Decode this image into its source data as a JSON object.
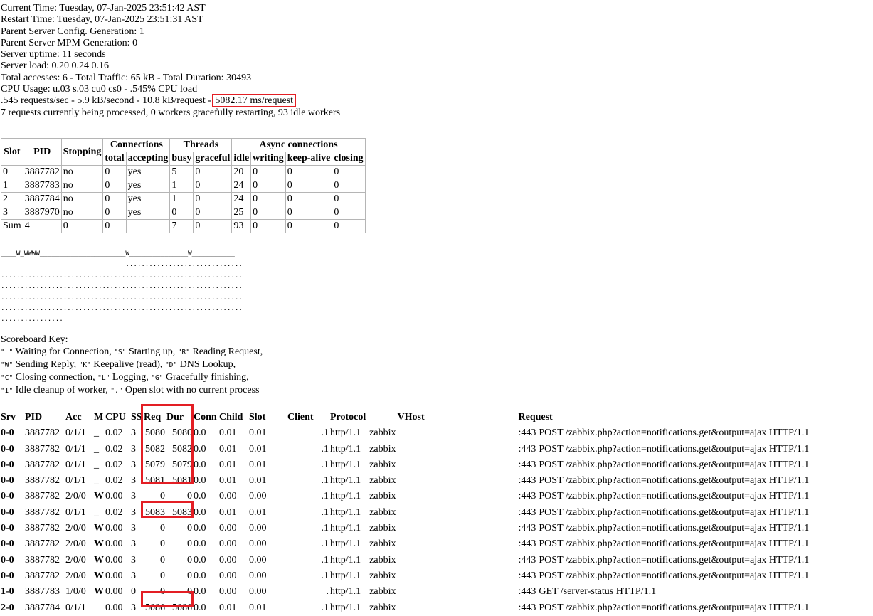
{
  "info": {
    "lines": [
      "Current Time: Tuesday, 07-Jan-2025 23:51:42 AST",
      "Restart Time: Tuesday, 07-Jan-2025 23:51:31 AST",
      "Parent Server Config. Generation: 1",
      "Parent Server MPM Generation: 0",
      "Server uptime: 11 seconds",
      "Server load: 0.20 0.24 0.16",
      "Total accesses: 6 - Total Traffic: 65 kB - Total Duration: 30493",
      "CPU Usage: u.03 s.03 cu0 cs0 - .545% CPU load"
    ],
    "requests_prefix": ".545 requests/sec - 5.9 kB/second - 10.8 kB/request - ",
    "requests_highlight": "5082.17 ms/request",
    "workers_line": "7 requests currently being processed, 0 workers gracefully restarting, 93 idle workers"
  },
  "workers_table": {
    "header_groups": {
      "connections": "Connections",
      "threads": "Threads",
      "async": "Async connections"
    },
    "headers": {
      "slot": "Slot",
      "pid": "PID",
      "stopping": "Stopping",
      "total": "total",
      "accepting": "accepting",
      "busy": "busy",
      "graceful": "graceful",
      "idle": "idle",
      "writing": "writing",
      "keepalive": "keep-alive",
      "closing": "closing"
    },
    "rows": [
      [
        "0",
        "3887782",
        "no",
        "0",
        "yes",
        "5",
        "0",
        "20",
        "0",
        "0",
        "0"
      ],
      [
        "1",
        "3887783",
        "no",
        "0",
        "yes",
        "1",
        "0",
        "24",
        "0",
        "0",
        "0"
      ],
      [
        "2",
        "3887784",
        "no",
        "0",
        "yes",
        "1",
        "0",
        "24",
        "0",
        "0",
        "0"
      ],
      [
        "3",
        "3887970",
        "no",
        "0",
        "yes",
        "0",
        "0",
        "25",
        "0",
        "0",
        "0"
      ],
      [
        "Sum",
        "4",
        "0",
        "0",
        "",
        "7",
        "0",
        "93",
        "0",
        "0",
        "0"
      ]
    ]
  },
  "scoreboard": [
    "____W_WWWW______________________W_______________W___________",
    "________________________________..............................",
    "..............................................................",
    "..............................................................",
    "..............................................................",
    "..............................................................",
    "................"
  ],
  "key": {
    "title": "Scoreboard Key:",
    "lines": [
      {
        "parts": [
          [
            "code",
            "\"_\""
          ],
          [
            "text",
            " Waiting for Connection, "
          ],
          [
            "code",
            "\"S\""
          ],
          [
            "text",
            " Starting up, "
          ],
          [
            "code",
            "\"R\""
          ],
          [
            "text",
            " Reading Request,"
          ]
        ]
      },
      {
        "parts": [
          [
            "code",
            "\"W\""
          ],
          [
            "text",
            " Sending Reply, "
          ],
          [
            "code",
            "\"K\""
          ],
          [
            "text",
            " Keepalive (read), "
          ],
          [
            "code",
            "\"D\""
          ],
          [
            "text",
            " DNS Lookup,"
          ]
        ]
      },
      {
        "parts": [
          [
            "code",
            "\"C\""
          ],
          [
            "text",
            " Closing connection, "
          ],
          [
            "code",
            "\"L\""
          ],
          [
            "text",
            " Logging, "
          ],
          [
            "code",
            "\"G\""
          ],
          [
            "text",
            " Gracefully finishing,"
          ]
        ]
      },
      {
        "parts": [
          [
            "code",
            "\"I\""
          ],
          [
            "text",
            " Idle cleanup of worker, "
          ],
          [
            "code",
            "\".\""
          ],
          [
            "text",
            " Open slot with no current process"
          ]
        ]
      }
    ]
  },
  "requests_table": {
    "headers": [
      "Srv",
      "PID",
      "Acc",
      "M",
      "CPU",
      "SS",
      "Req",
      "Dur",
      "Conn",
      "Child",
      "Slot",
      "Client",
      "Protocol",
      "VHost",
      "Request"
    ],
    "rows": [
      [
        "0-0",
        "3887782",
        "0/1/1",
        "_",
        "0.02",
        "3",
        "5080",
        "5080",
        "0.0",
        "0.01",
        "0.01",
        ".1",
        "http/1.1",
        "zabbix",
        ":443",
        "POST /zabbix.php?action=notifications.get&output=ajax HTTP/1.1"
      ],
      [
        "0-0",
        "3887782",
        "0/1/1",
        "_",
        "0.02",
        "3",
        "5082",
        "5082",
        "0.0",
        "0.01",
        "0.01",
        ".1",
        "http/1.1",
        "zabbix",
        ":443",
        "POST /zabbix.php?action=notifications.get&output=ajax HTTP/1.1"
      ],
      [
        "0-0",
        "3887782",
        "0/1/1",
        "_",
        "0.02",
        "3",
        "5079",
        "5079",
        "0.0",
        "0.01",
        "0.01",
        ".1",
        "http/1.1",
        "zabbix",
        ":443",
        "POST /zabbix.php?action=notifications.get&output=ajax HTTP/1.1"
      ],
      [
        "0-0",
        "3887782",
        "0/1/1",
        "_",
        "0.02",
        "3",
        "5081",
        "5081",
        "0.0",
        "0.01",
        "0.01",
        ".1",
        "http/1.1",
        "zabbix",
        ":443",
        "POST /zabbix.php?action=notifications.get&output=ajax HTTP/1.1"
      ],
      [
        "0-0",
        "3887782",
        "2/0/0",
        "W",
        "0.00",
        "3",
        "0",
        "0",
        "0.0",
        "0.00",
        "0.00",
        ".1",
        "http/1.1",
        "zabbix",
        ":443",
        "POST /zabbix.php?action=notifications.get&output=ajax HTTP/1.1"
      ],
      [
        "0-0",
        "3887782",
        "0/1/1",
        "_",
        "0.02",
        "3",
        "5083",
        "5083",
        "0.0",
        "0.01",
        "0.01",
        ".1",
        "http/1.1",
        "zabbix",
        ":443",
        "POST /zabbix.php?action=notifications.get&output=ajax HTTP/1.1"
      ],
      [
        "0-0",
        "3887782",
        "2/0/0",
        "W",
        "0.00",
        "3",
        "0",
        "0",
        "0.0",
        "0.00",
        "0.00",
        ".1",
        "http/1.1",
        "zabbix",
        ":443",
        "POST /zabbix.php?action=notifications.get&output=ajax HTTP/1.1"
      ],
      [
        "0-0",
        "3887782",
        "2/0/0",
        "W",
        "0.00",
        "3",
        "0",
        "0",
        "0.0",
        "0.00",
        "0.00",
        ".1",
        "http/1.1",
        "zabbix",
        ":443",
        "POST /zabbix.php?action=notifications.get&output=ajax HTTP/1.1"
      ],
      [
        "0-0",
        "3887782",
        "2/0/0",
        "W",
        "0.00",
        "3",
        "0",
        "0",
        "0.0",
        "0.00",
        "0.00",
        ".1",
        "http/1.1",
        "zabbix",
        ":443",
        "POST /zabbix.php?action=notifications.get&output=ajax HTTP/1.1"
      ],
      [
        "0-0",
        "3887782",
        "2/0/0",
        "W",
        "0.00",
        "3",
        "0",
        "0",
        "0.0",
        "0.00",
        "0.00",
        ".1",
        "http/1.1",
        "zabbix",
        ":443",
        "POST /zabbix.php?action=notifications.get&output=ajax HTTP/1.1"
      ],
      [
        "1-0",
        "3887783",
        "1/0/0",
        "W",
        "0.00",
        "0",
        "0",
        "0",
        "0.0",
        "0.00",
        "0.00",
        ".",
        "http/1.1",
        "zabbix",
        ":443",
        "GET /server-status HTTP/1.1"
      ],
      [
        "2-0",
        "3887784",
        "0/1/1",
        "",
        "0.00",
        "3",
        "5086",
        "5086",
        "0.0",
        "0.01",
        "0.01",
        ".1",
        "http/1.1",
        "zabbix",
        ":443",
        "POST /zabbix.php?action=notifications.get&output=ajax HTTP/1.1"
      ]
    ]
  },
  "annotation_color": "#e31e24"
}
